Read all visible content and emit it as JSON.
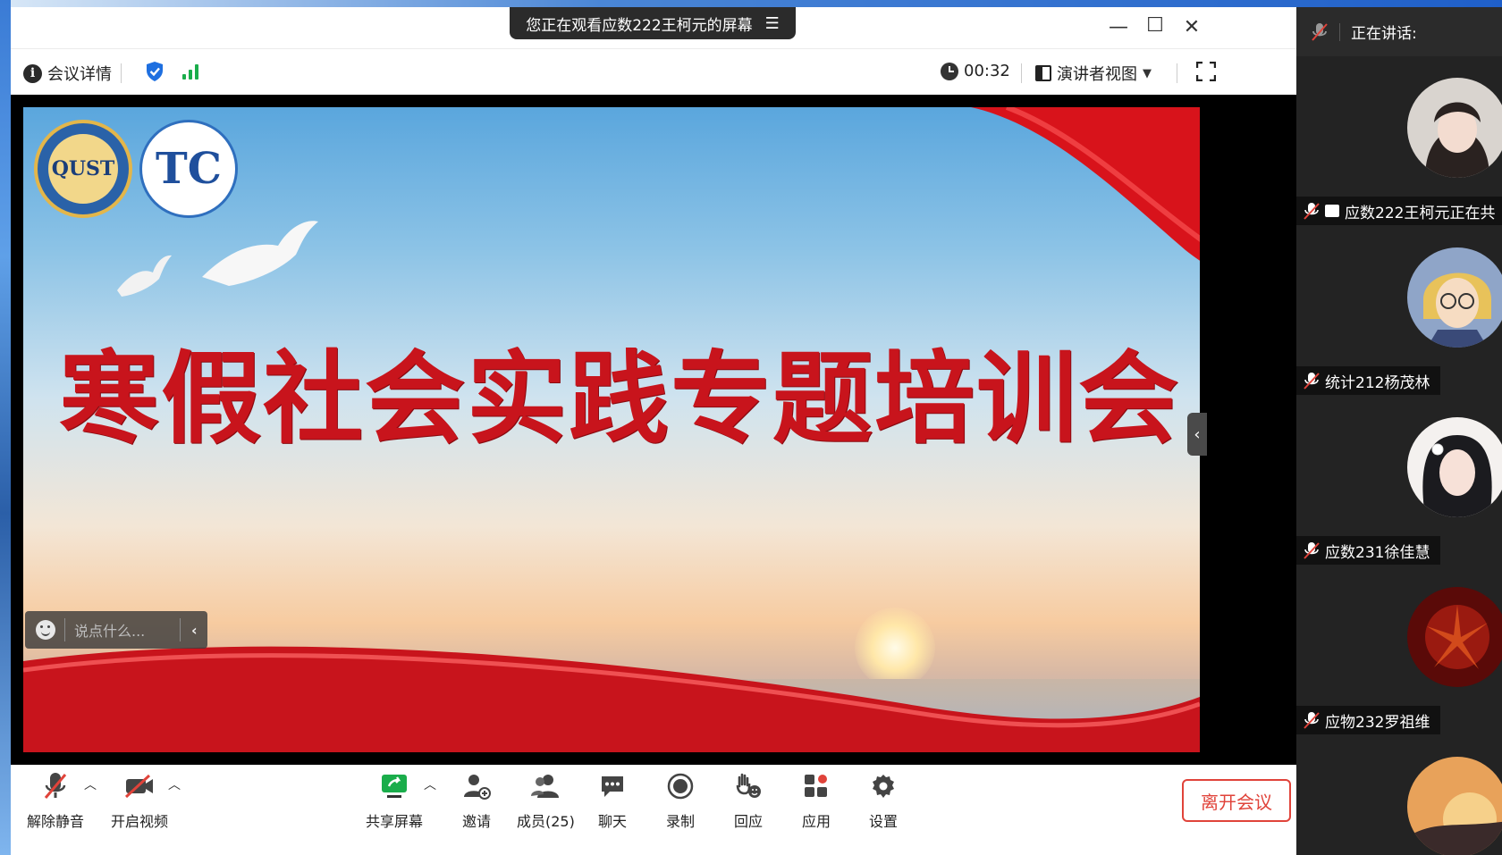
{
  "share_banner": {
    "text": "您正在观看应数222王柯元的屏幕"
  },
  "toolbar": {
    "meeting_info_label": "会议详情",
    "timer": "00:32",
    "view_label": "演讲者视图"
  },
  "slide": {
    "title": "寒假社会实践专题培训会",
    "logo1_text": "QUST",
    "logo2_text": "TC"
  },
  "chat": {
    "placeholder": "说点什么..."
  },
  "controls": {
    "unmute": "解除静音",
    "start_video": "开启视频",
    "share_screen": "共享屏幕",
    "invite": "邀请",
    "members": "成员(25)",
    "chat": "聊天",
    "record": "录制",
    "reactions": "回应",
    "apps": "应用",
    "settings": "设置",
    "leave": "离开会议"
  },
  "panel": {
    "speaking_label": "正在讲话:",
    "participants": [
      {
        "name": "应数222王柯元正在共",
        "sharing": true
      },
      {
        "name": "统计212杨茂林",
        "sharing": false
      },
      {
        "name": "应数231徐佳慧",
        "sharing": false
      },
      {
        "name": "应物232罗祖维",
        "sharing": false
      }
    ]
  },
  "colors": {
    "accent_red": "#c8141c",
    "leave_red": "#e0433a",
    "signal_green": "#1aad4b",
    "shield_blue": "#1e6fe0"
  }
}
